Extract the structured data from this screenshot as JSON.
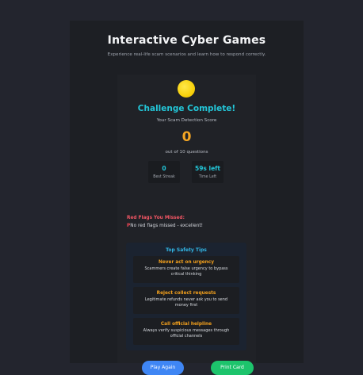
{
  "header": {
    "title": "Interactive Cyber Games",
    "subtitle": "Experience real-life scam scenarios and learn how to respond correctly."
  },
  "result": {
    "icon": "sun-icon",
    "title": "Challenge Complete!",
    "score_label": "Your Scam Detection Score",
    "score": "0",
    "score_caption": "out of 10 questions"
  },
  "stats": [
    {
      "value": "0",
      "label": "Best Streak"
    },
    {
      "value": "59s left",
      "label": "Time Left"
    }
  ],
  "red_flags": {
    "title": "Red Flags You Missed:",
    "flag_icon": "P",
    "message": "No red flags missed - excellent!"
  },
  "tips": {
    "title": "Top Safety Tips",
    "items": [
      {
        "title": "Never act on urgency",
        "text": "Scammers create false urgency to bypass critical thinking"
      },
      {
        "title": "Reject collect requests",
        "text": "Legitimate refunds never ask you to send money first"
      },
      {
        "title": "Call official helpline",
        "text": "Always verify suspicious messages through official channels"
      }
    ]
  },
  "buttons": {
    "play_again": "Play Again",
    "print_card": "Print Card"
  },
  "colors": {
    "accent": "#23c6d8",
    "score": "#f5a623",
    "play": "#3f86f4",
    "print": "#1dc46c",
    "alert": "#f15664"
  }
}
